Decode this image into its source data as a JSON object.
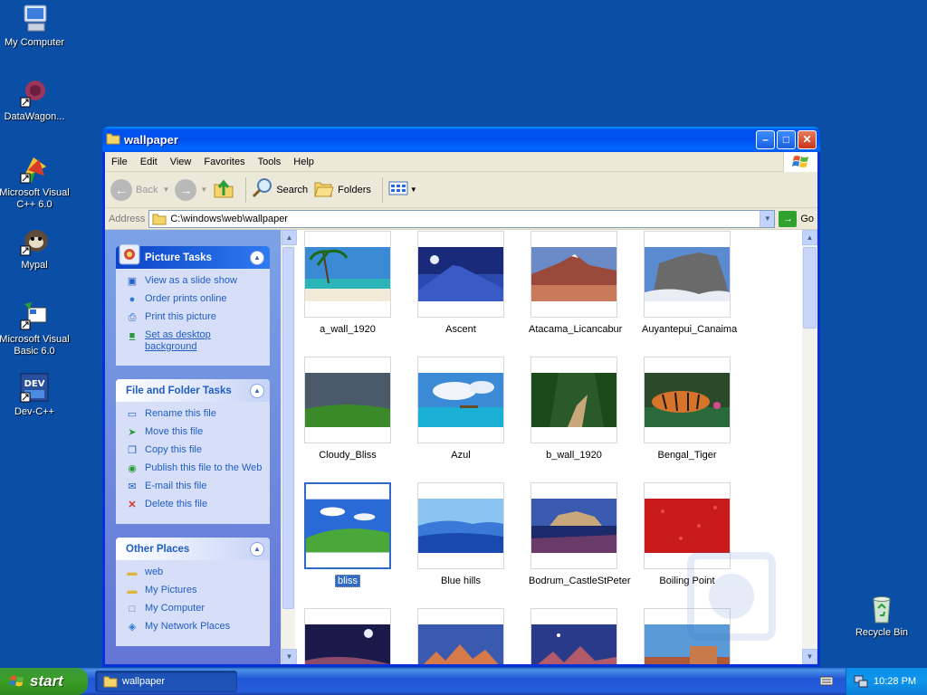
{
  "desktop": {
    "icons": [
      {
        "label": "My Computer",
        "icon": "my-computer-icon"
      },
      {
        "label": "DataWagon...",
        "icon": "datawagon-icon"
      },
      {
        "label": "Microsoft Visual C++ 6.0",
        "icon": "visual-cpp-icon"
      },
      {
        "label": "Mypal",
        "icon": "mypal-icon"
      },
      {
        "label": "Microsoft Visual Basic 6.0",
        "icon": "visual-basic-icon"
      },
      {
        "label": "Dev-C++",
        "icon": "dev-cpp-icon"
      },
      {
        "label": "Recycle Bin",
        "icon": "recycle-bin-icon"
      }
    ]
  },
  "window": {
    "title": "wallpaper",
    "menu": [
      "File",
      "Edit",
      "View",
      "Favorites",
      "Tools",
      "Help"
    ],
    "toolbar": {
      "back": "Back",
      "search": "Search",
      "folders": "Folders"
    },
    "address": {
      "label": "Address",
      "value": "C:\\windows\\web\\wallpaper",
      "go": "Go"
    }
  },
  "sidebar": {
    "picture_tasks": {
      "title": "Picture Tasks",
      "items": [
        "View as a slide show",
        "Order prints online",
        "Print this picture",
        "Set as desktop background"
      ]
    },
    "file_tasks": {
      "title": "File and Folder Tasks",
      "items": [
        "Rename this file",
        "Move this file",
        "Copy this file",
        "Publish this file to the Web",
        "E-mail this file",
        "Delete this file"
      ]
    },
    "other_places": {
      "title": "Other Places",
      "items": [
        "web",
        "My Pictures",
        "My Computer",
        "My Network Places"
      ]
    }
  },
  "files": [
    {
      "name": "a_wall_1920"
    },
    {
      "name": "Ascent"
    },
    {
      "name": "Atacama_Licancabur"
    },
    {
      "name": "Auyantepui_Canaima"
    },
    {
      "name": "Cloudy_Bliss"
    },
    {
      "name": "Azul"
    },
    {
      "name": "b_wall_1920"
    },
    {
      "name": "Bengal_Tiger"
    },
    {
      "name": "bliss",
      "selected": true
    },
    {
      "name": "Blue hills"
    },
    {
      "name": "Bodrum_CastleStPeter"
    },
    {
      "name": "Boiling Point"
    }
  ],
  "taskbar": {
    "start": "start",
    "task": "wallpaper",
    "clock": "10:28 PM"
  },
  "colors": {
    "desktop": "#0b4ea6",
    "link": "#215dc6",
    "selection": "#316ac5"
  }
}
